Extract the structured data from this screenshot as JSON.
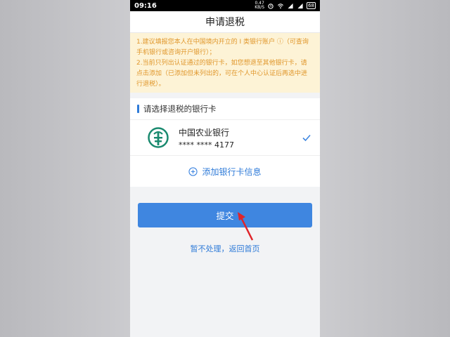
{
  "status": {
    "time": "09:16",
    "net_speed_value": "0.47",
    "net_speed_unit": "KB/S",
    "battery": "68"
  },
  "header": {
    "title": "申请退税"
  },
  "notice": {
    "line1": "1.建议填报您本人在中国境内开立的 I 类银行账户 ⓘ（可查询手机银行或咨询开户银行）；",
    "line2": "2.当前只列出认证通过的银行卡，如您想退至其他银行卡，请点击添加（已添加但未列出的，可在个人中心认证后再选中进行退税）。"
  },
  "bank_section": {
    "title": "请选择退税的银行卡",
    "cards": [
      {
        "name": "中国农业银行",
        "number": "**** **** 4177"
      }
    ],
    "add_label": "添加银行卡信息"
  },
  "actions": {
    "submit_label": "提交",
    "skip_label": "暂不处理，返回首页"
  },
  "colors": {
    "accent": "#3f86e0",
    "notice_bg": "#fdf3d6",
    "notice_text": "#e0962a",
    "bank_logo": "#1a8a6f",
    "annotation_arrow": "#e0242a"
  }
}
